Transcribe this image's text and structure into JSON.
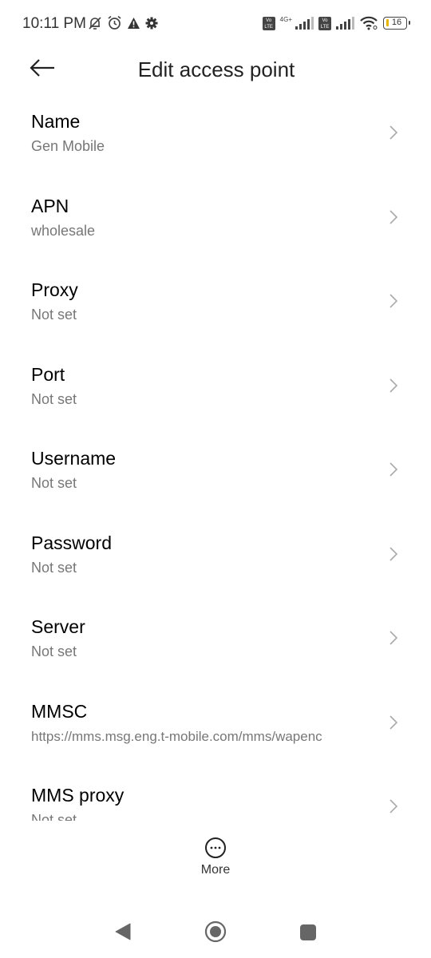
{
  "status_bar": {
    "time": "10:11 PM",
    "left_icons": [
      "bell-off-icon",
      "alarm-icon",
      "warning-icon",
      "gear-icon"
    ],
    "network_type": "4G+",
    "volte_label": "Vo LTE",
    "battery_level": "16"
  },
  "header": {
    "back_icon": "arrow-left-icon",
    "title": "Edit access point"
  },
  "fields": [
    {
      "label": "Name",
      "value": "Gen Mobile"
    },
    {
      "label": "APN",
      "value": "wholesale"
    },
    {
      "label": "Proxy",
      "value": "Not set"
    },
    {
      "label": "Port",
      "value": "Not set"
    },
    {
      "label": "Username",
      "value": "Not set"
    },
    {
      "label": "Password",
      "value": "Not set"
    },
    {
      "label": "Server",
      "value": "Not set"
    },
    {
      "label": "MMSC",
      "value": "https://mms.msg.eng.t-mobile.com/mms/wapenc"
    },
    {
      "label": "MMS proxy",
      "value": "Not set"
    }
  ],
  "footer": {
    "more_label": "More",
    "more_icon": "more-horizontal-circle-icon"
  },
  "nav_bar": {
    "back_icon": "nav-back-triangle-icon",
    "home_icon": "nav-home-circle-icon",
    "recents_icon": "nav-recents-square-icon"
  }
}
